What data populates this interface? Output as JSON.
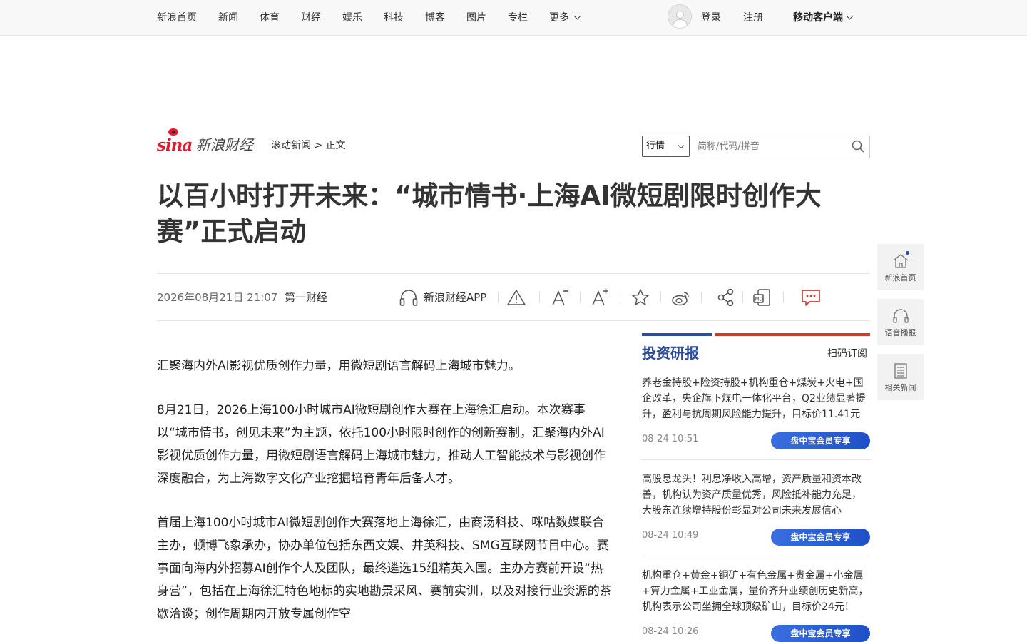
{
  "nav": {
    "items": [
      "新浪首页",
      "新闻",
      "体育",
      "财经",
      "娱乐",
      "科技",
      "博客",
      "图片",
      "专栏"
    ],
    "more": "更多",
    "login": "登录",
    "register": "注册",
    "mobile": "移动客户端"
  },
  "header": {
    "logo_text": "sina",
    "brand": "新浪财经",
    "breadcrumb": [
      "滚动新闻",
      ">",
      "正文"
    ],
    "search": {
      "select": "行情",
      "placeholder": "简称/代码/拼音"
    }
  },
  "article": {
    "title": "以百小时打开未来：“城市情书·上海AI微短剧限时创作大赛”正式启动",
    "datetime": "2026年08月21日 21:07",
    "source": "第一财经",
    "app_label": "新浪财经APP",
    "paragraphs": [
      "汇聚海内外AI影视优质创作力量，用微短剧语言解码上海城市魅力。",
      "8月21日，2026上海100小时城市AI微短剧创作大赛在上海徐汇启动。本次赛事以“城市情书，创见未来”为主题，依托100小时限时创作的创新赛制，汇聚海内外AI影视优质创作力量，用微短剧语言解码上海城市魅力，推动人工智能技术与影视创作深度融合，为上海数字文化产业挖掘培育青年后备人才。",
      "首届上海100小时城市AI微短剧创作大赛落地上海徐汇，由商汤科技、咪咕数媒联合主办，顿博飞象承办，协办单位包括东西文娱、井英科技、SMG互联网节目中心。赛事面向海内外招募AI创作个人及团队，最终遴选15组精英入围。主办方赛前开设“热身营”，包括在上海徐汇特色地标的实地勘景采风、赛前实训，以及对接行业资源的茶歇洽谈；创作周期内开放专属创作空"
    ]
  },
  "toolbar_icons": [
    "headphone-icon",
    "report-icon",
    "font-decrease-icon",
    "font-increase-icon",
    "star-icon",
    "weibo-icon",
    "share-icon",
    "wechat-icon",
    "comment-icon"
  ],
  "research": {
    "title": "投资研报",
    "subscribe": "扫码订阅",
    "items": [
      {
        "text": "养老金持股+险资持股+机构重仓+煤炭+火电+国企改革，央企旗下煤电一体化平台，Q2业绩显著提升，盈利与抗周期风险能力提升，目标价11.41元",
        "time": "08-24 10:51",
        "badge": "盘中宝会员专享"
      },
      {
        "text": "高股息龙头！利息净收入高增，资产质量和资本改善，机构认为资产质量优秀，风险抵补能力充足，大股东连续增持股份彰显对公司未来发展信心",
        "time": "08-24 10:49",
        "badge": "盘中宝会员专享"
      },
      {
        "text": "机构重仓+黄金+铜矿+有色金属+贵金属+小金属+算力金属+工业金属，量价齐升业绩创历史新高，机构表示公司坐拥全球顶级矿山，目标价24元！",
        "time": "08-24 10:26",
        "badge": "盘中宝会员专享"
      }
    ]
  },
  "side": {
    "home": "新浪首页",
    "audio": "语音播报",
    "related": "相关新闻"
  },
  "colors": {
    "accent": "#2b4c9b",
    "brand_red": "#e6162d",
    "badge_blue": "#2a5ad6"
  }
}
